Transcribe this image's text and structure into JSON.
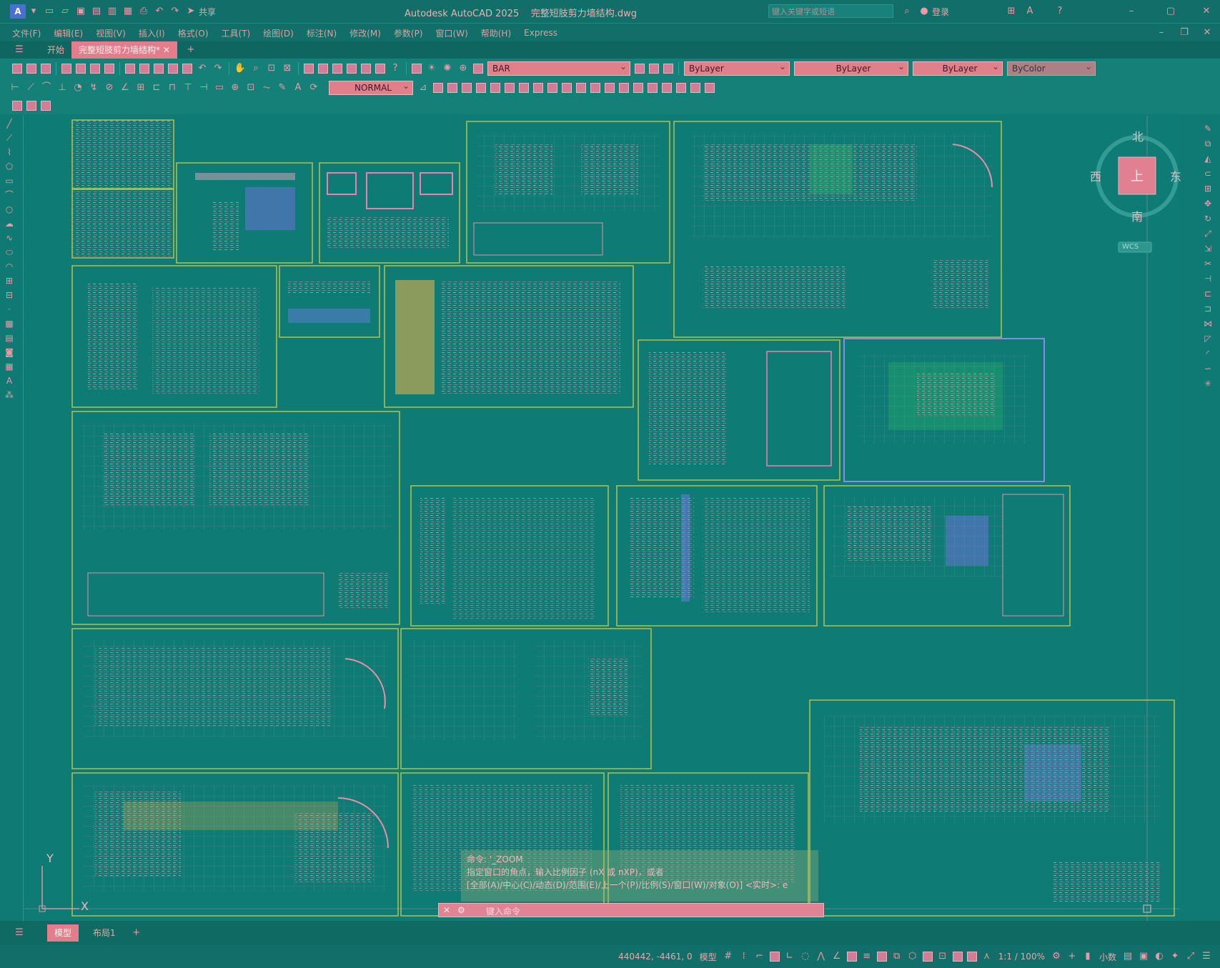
{
  "app": {
    "title": "Autodesk AutoCAD 2025",
    "filename": "完整短肢剪力墙结构.dwg",
    "search_placeholder": "键入关键字或短语",
    "login": "登录",
    "share": "共享"
  },
  "menu": [
    "文件(F)",
    "编辑(E)",
    "视图(V)",
    "插入(I)",
    "格式(O)",
    "工具(T)",
    "绘图(D)",
    "标注(N)",
    "修改(M)",
    "参数(P)",
    "窗口(W)",
    "帮助(H)",
    "Express"
  ],
  "tabs": {
    "start": "开始",
    "file_tab": "完整短肢剪力墙结构*"
  },
  "toolbar": {
    "layer": "BAR",
    "color": "ByLayer",
    "linetype": "ByLayer",
    "lineweight": "ByLayer",
    "plotstyle": "ByColor",
    "dimstyle": "NORMAL"
  },
  "viewcube": {
    "north": "北",
    "south": "南",
    "east": "东",
    "west": "西",
    "top": "上",
    "ucs": "WCS"
  },
  "ucs_icon": {
    "y_label": "Y",
    "x_label": "X"
  },
  "command": {
    "line1": "命令: '_ZOOM",
    "line2": "指定窗口的角点，输入比例因子 (nX 或 nXP)，或者",
    "line3": "[全部(A)/中心(C)/动态(D)/范围(E)/上一个(P)/比例(S)/窗口(W)/对象(O)] <实时>: e",
    "placeholder": "键入命令"
  },
  "layout_tabs": {
    "model": "模型",
    "layout1": "布局1"
  },
  "status": {
    "coords": "440442, -4461, 0",
    "model": "模型",
    "scale": "1:1 / 100%",
    "units": "小数"
  },
  "colors": {
    "background": "#0f7a74",
    "accent": "#e57c8c",
    "sheet_border": "#b9c24a",
    "dropdown_bg": "#e0808a"
  }
}
